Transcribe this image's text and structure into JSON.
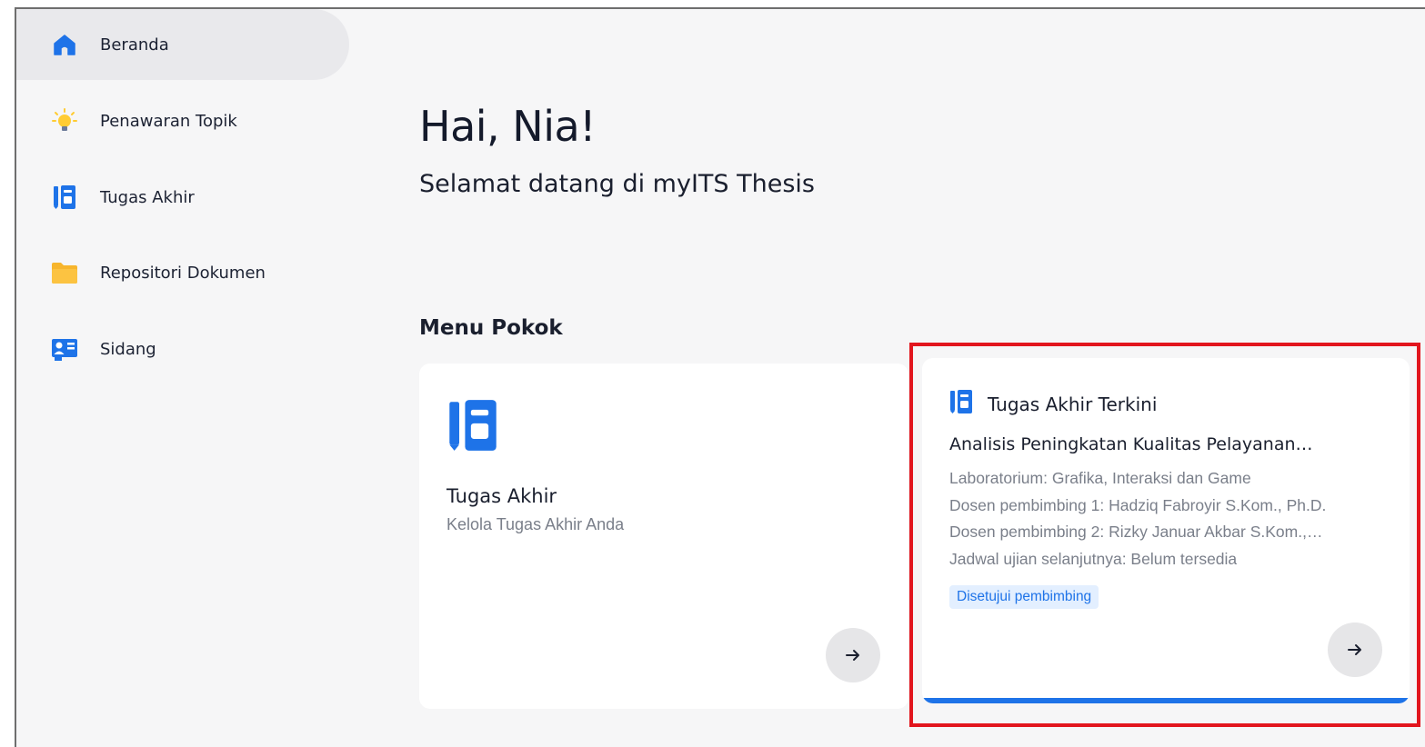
{
  "sidebar": {
    "items": [
      {
        "label": "Beranda",
        "icon": "home-icon",
        "active": true
      },
      {
        "label": "Penawaran Topik",
        "icon": "lightbulb-icon"
      },
      {
        "label": "Tugas Akhir",
        "icon": "notebook-icon"
      },
      {
        "label": "Repositori Dokumen",
        "icon": "folder-icon"
      },
      {
        "label": "Sidang",
        "icon": "id-card-icon"
      }
    ]
  },
  "main": {
    "greeting": "Hai, Nia!",
    "subtitle": "Selamat datang di myITS Thesis",
    "section_title": "Menu Pokok",
    "card_tugas_akhir": {
      "title": "Tugas Akhir",
      "subtitle": "Kelola Tugas Akhir Anda"
    },
    "card_current": {
      "header": "Tugas Akhir Terkini",
      "title": "Analisis Peningkatan Kualitas Pelayanan…",
      "lines": [
        "Laboratorium: Grafika, Interaksi dan Game",
        "Dosen pembimbing 1: Hadziq Fabroyir S.Kom., Ph.D.",
        "Dosen pembimbing 2: Rizky Januar Akbar S.Kom.,…",
        "Jadwal ujian selanjutnya: Belum tersedia"
      ],
      "badge": "Disetujui pembimbing"
    }
  },
  "colors": {
    "accent": "#1e73e8",
    "folder": "#f7b52c",
    "bulb": "#ffcc33",
    "highlight": "#e2161e"
  }
}
